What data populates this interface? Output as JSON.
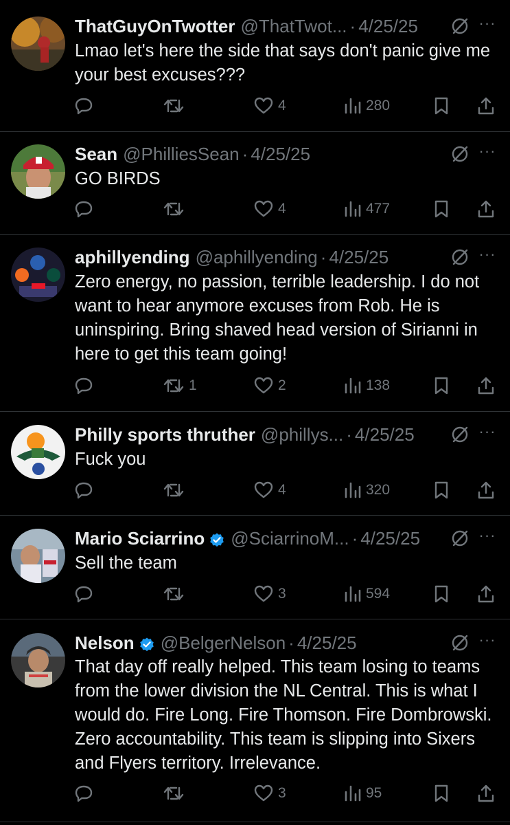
{
  "tweets": [
    {
      "name": "ThatGuyOnTwotter",
      "handle": "@ThatTwot...",
      "date": "4/25/25",
      "verified": false,
      "text": "Lmao let's here the side that says don't panic give me your best excuses???",
      "replies": "",
      "retweets": "",
      "likes": "4",
      "views": "280"
    },
    {
      "name": "Sean",
      "handle": "@PhilliesSean",
      "date": "4/25/25",
      "verified": false,
      "text": "GO BIRDS",
      "replies": "",
      "retweets": "",
      "likes": "4",
      "views": "477"
    },
    {
      "name": "aphillyending",
      "handle": "@aphillyending",
      "date": "4/25/25",
      "verified": false,
      "text": "Zero energy, no passion, terrible leadership. I do not want to hear anymore excuses from Rob. He is uninspiring. Bring shaved head version of Sirianni in here to get this team going!",
      "replies": "",
      "retweets": "1",
      "likes": "2",
      "views": "138"
    },
    {
      "name": "Philly sports thruther",
      "handle": "@phillys...",
      "date": "4/25/25",
      "verified": false,
      "text": "Fuck you",
      "replies": "",
      "retweets": "",
      "likes": "4",
      "views": "320"
    },
    {
      "name": "Mario Sciarrino",
      "handle": "@SciarrinoM...",
      "date": "4/25/25",
      "verified": true,
      "text": "Sell the team",
      "replies": "",
      "retweets": "",
      "likes": "3",
      "views": "594"
    },
    {
      "name": "Nelson",
      "handle": "@BelgerNelson",
      "date": "4/25/25",
      "verified": true,
      "text": "That day off really helped. This team losing to teams from the lower division the NL Central. This is what I would do. Fire Long. Fire Thomson. Fire Dombrowski. Zero accountability. This team is slipping into Sixers and Flyers territory. Irrelevance.",
      "replies": "",
      "retweets": "",
      "likes": "3",
      "views": "95"
    }
  ],
  "colors": {
    "background": "#000000",
    "text": "#e7e9ea",
    "muted": "#71767b",
    "divider": "#2f3336",
    "verified": "#1d9bf0"
  },
  "icons": {
    "reply": "reply-icon",
    "retweet": "retweet-icon",
    "like": "heart-icon",
    "views": "views-bar-chart-icon",
    "bookmark": "bookmark-icon",
    "share": "share-icon",
    "grok": "grok-icon",
    "more": "more-icon"
  }
}
